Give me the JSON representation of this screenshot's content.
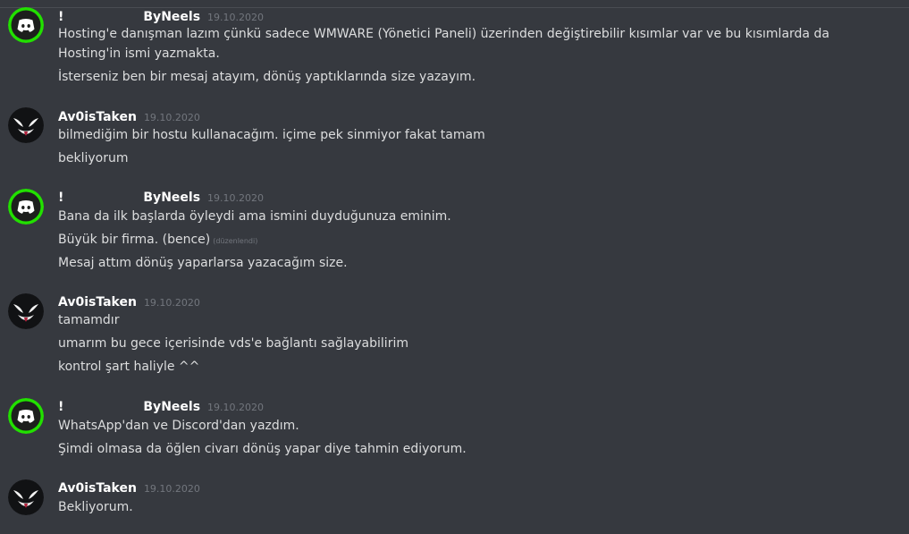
{
  "colors": {
    "background": "#36393f",
    "text": "#dcddde",
    "username": "#ffffff",
    "timestamp": "#72767d",
    "discord_avatar_ring": "#22e000",
    "discord_avatar_bg": "#1d1f1d"
  },
  "icons": {
    "discord_avatar": "discord-logo-icon",
    "venom_avatar": "venom-face-icon"
  },
  "messages": [
    {
      "prefix": "!",
      "author": "ByNeels",
      "timestamp": "19.10.2020",
      "avatar": "discord-logo-icon",
      "lines": [
        "Hosting'e danışman lazım çünkü sadece WMWARE (Yönetici Paneli) üzerinden değiştirebilir kısımlar var ve bu kısımlarda da Hosting'in ismi yazmakta.",
        "İsterseniz ben bir mesaj atayım, dönüş yaptıklarında size yazayım."
      ]
    },
    {
      "author": "Av0isTaken",
      "timestamp": "19.10.2020",
      "avatar": "venom-face-icon",
      "lines": [
        "bilmediğim bir hostu kullanacağım. içime pek sinmiyor fakat tamam",
        "bekliyorum"
      ]
    },
    {
      "prefix": "!",
      "author": "ByNeels",
      "timestamp": "19.10.2020",
      "avatar": "discord-logo-icon",
      "lines": [
        "Bana da ilk başlarda öyleydi ama ismini duyduğunuza eminim.",
        "Büyük bir firma. (bence)",
        "Mesaj attım dönüş yaparlarsa yazacağım size."
      ],
      "edited_label": "(düzenlendi)"
    },
    {
      "author": "Av0isTaken",
      "timestamp": "19.10.2020",
      "avatar": "venom-face-icon",
      "lines": [
        "tamamdır",
        "umarım bu gece içerisinde vds'e bağlantı sağlayabilirim",
        "kontrol şart haliyle ^^"
      ]
    },
    {
      "prefix": "!",
      "author": "ByNeels",
      "timestamp": "19.10.2020",
      "avatar": "discord-logo-icon",
      "lines": [
        "WhatsApp'dan ve Discord'dan yazdım.",
        "Şimdi olmasa da öğlen civarı dönüş yapar diye tahmin ediyorum."
      ]
    },
    {
      "author": "Av0isTaken",
      "timestamp": "19.10.2020",
      "avatar": "venom-face-icon",
      "lines": [
        "Bekliyorum."
      ]
    }
  ]
}
